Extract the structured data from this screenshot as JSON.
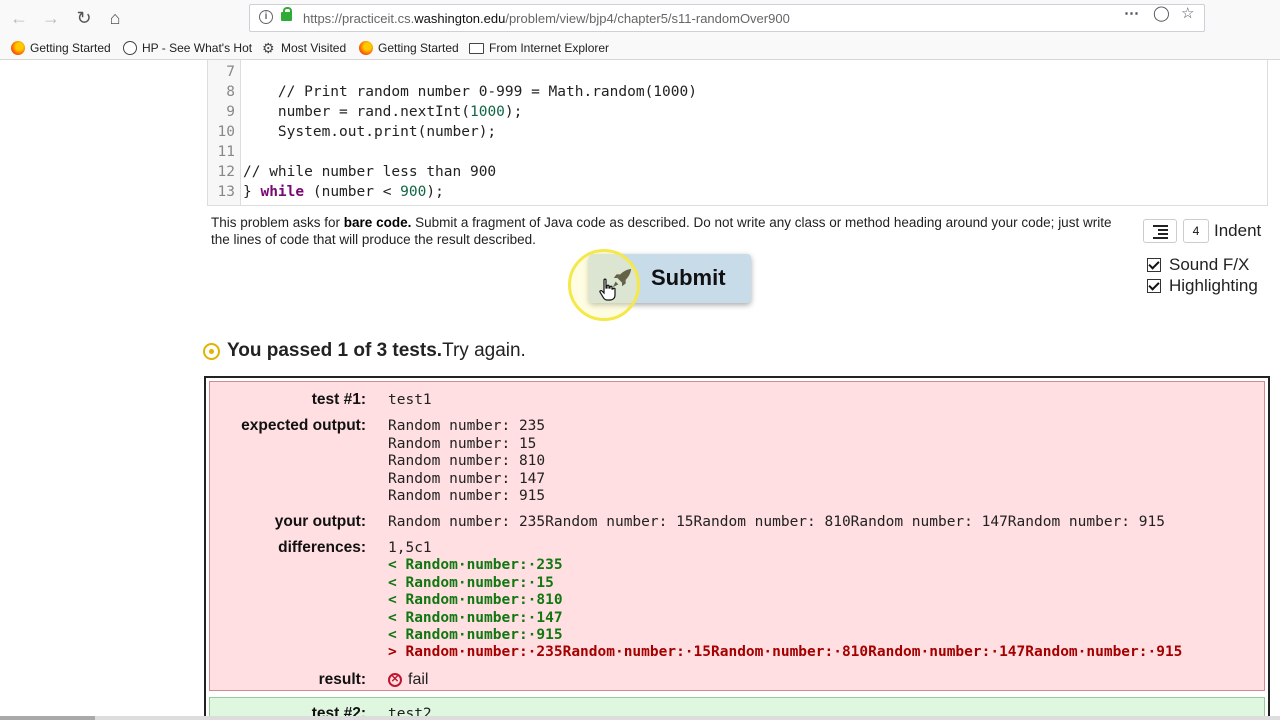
{
  "browser": {
    "url_prefix": "https://practiceit.cs.",
    "url_domain": "washington.edu",
    "url_path": "/problem/view/bjp4/chapter5/s11-randomOver900",
    "bookmarks": [
      {
        "label": "Getting Started",
        "icon": "firefox-icon"
      },
      {
        "label": "HP - See What's Hot",
        "icon": "globe-icon"
      },
      {
        "label": "Most Visited",
        "icon": "gear-icon"
      },
      {
        "label": "Getting Started",
        "icon": "firefox-icon"
      },
      {
        "label": "From Internet Explorer",
        "icon": "folder-icon"
      }
    ]
  },
  "code": {
    "lines": [
      {
        "n": "7",
        "text": ""
      },
      {
        "n": "8",
        "text": "    // Print random number 0-999 = Math.random(1000)"
      },
      {
        "n": "9",
        "text": "    number = rand.nextInt(1000);"
      },
      {
        "n": "10",
        "text": "    System.out.print(number);"
      },
      {
        "n": "11",
        "text": ""
      },
      {
        "n": "12",
        "text": "// while number less than 900"
      },
      {
        "n": "13",
        "text": "} while (number < 900);"
      }
    ]
  },
  "problem": {
    "desc_pre": "This problem asks for ",
    "desc_bold": "bare code.",
    "desc_post": " Submit a fragment of Java code as described. Do not write any class or method heading around your code; just write the lines of code that will produce the result described."
  },
  "options": {
    "indent_value": "4",
    "indent_label": "Indent",
    "sound_label": "Sound F/X",
    "highlight_label": "Highlighting"
  },
  "submit": {
    "label": "Submit"
  },
  "summary": {
    "bold": "You passed 1 of 3 tests.",
    "rest": " Try again."
  },
  "test1": {
    "labels": {
      "test": "test #1:",
      "expected": "expected output:",
      "yours": "your output:",
      "diff": "differences:",
      "result": "result:"
    },
    "name": "test1",
    "expected": "Random number: 235\nRandom number: 15\nRandom number: 810\nRandom number: 147\nRandom number: 915",
    "your_output": "Random number: 235Random number: 15Random number: 810Random number: 147Random number: 915",
    "diff_header": "1,5c1",
    "diff_green": "< Random·number:·235\n< Random·number:·15\n< Random·number:·810\n< Random·number:·147\n< Random·number:·915",
    "diff_red": "> Random·number:·235Random·number:·15Random·number:·810Random·number:·147Random·number:·915",
    "result": "fail"
  },
  "test2": {
    "label": "test #2:",
    "name": "test2"
  },
  "colors": {
    "fail_bg": "#ffdfe1",
    "pass_bg": "#dff7df",
    "diff_green": "#117711",
    "diff_red": "#a40000",
    "submit_bg": "#c8dbe9"
  }
}
